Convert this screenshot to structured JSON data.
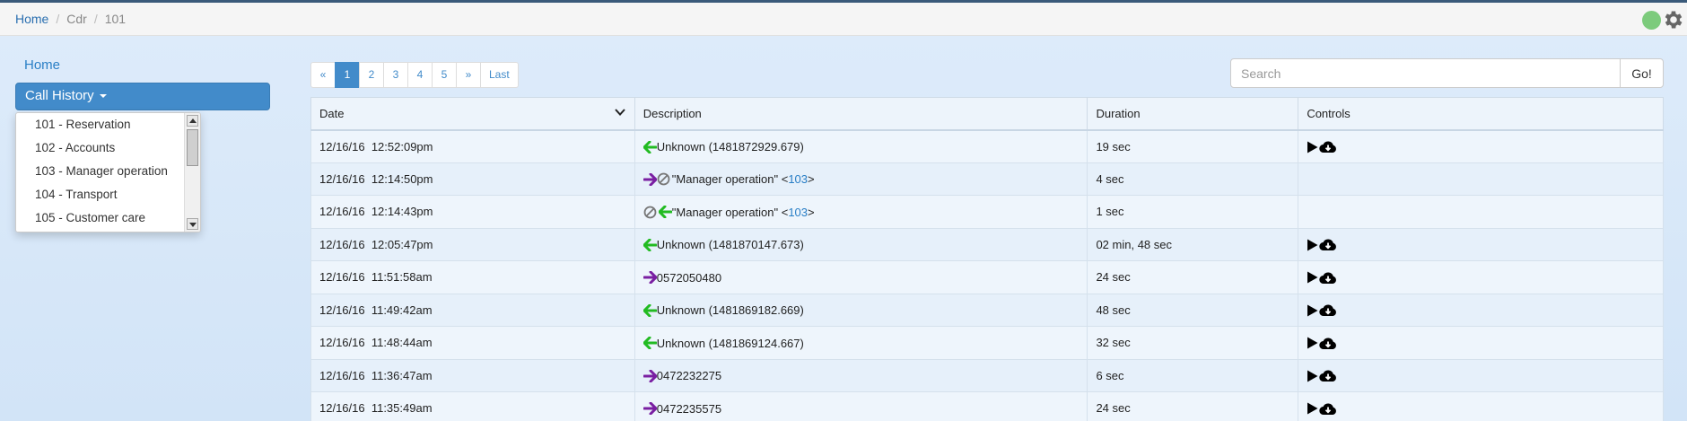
{
  "breadcrumb": {
    "home": "Home",
    "cdr": "Cdr",
    "current": "101"
  },
  "sidebar": {
    "home_link": "Home",
    "call_history_label": "Call History",
    "dropdown_items": [
      "101 - Reservation",
      "102 - Accounts",
      "103 - Manager operation",
      "104 - Transport",
      "105 - Customer care"
    ]
  },
  "pagination": [
    "«",
    "1",
    "2",
    "3",
    "4",
    "5",
    "»",
    "Last"
  ],
  "pagination_active": "1",
  "search": {
    "placeholder": "Search",
    "button": "Go!"
  },
  "table": {
    "headers": {
      "date": "Date",
      "description": "Description",
      "duration": "Duration",
      "controls": "Controls"
    },
    "rows": [
      {
        "date": "12/16/16  12:52:09pm",
        "icons": [
          "incoming"
        ],
        "text": "Unknown (1481872929.679)",
        "duration": "19 sec",
        "controls": true
      },
      {
        "date": "12/16/16  12:14:50pm",
        "icons": [
          "outgoing",
          "blocked"
        ],
        "text": "\"Manager operation\" <",
        "ext": "103",
        "suffix": ">",
        "duration": "4 sec",
        "controls": false
      },
      {
        "date": "12/16/16  12:14:43pm",
        "icons": [
          "blocked",
          "incoming"
        ],
        "text": "\"Manager operation\" <",
        "ext": "103",
        "suffix": ">",
        "duration": "1 sec",
        "controls": false
      },
      {
        "date": "12/16/16  12:05:47pm",
        "icons": [
          "incoming"
        ],
        "text": "Unknown (1481870147.673)",
        "duration": "02 min, 48 sec",
        "controls": true
      },
      {
        "date": "12/16/16  11:51:58am",
        "icons": [
          "outgoing"
        ],
        "text": "0572050480",
        "duration": "24 sec",
        "controls": true
      },
      {
        "date": "12/16/16  11:49:42am",
        "icons": [
          "incoming"
        ],
        "text": "Unknown (1481869182.669)",
        "duration": "48 sec",
        "controls": true
      },
      {
        "date": "12/16/16  11:48:44am",
        "icons": [
          "incoming"
        ],
        "text": "Unknown (1481869124.667)",
        "duration": "32 sec",
        "controls": true
      },
      {
        "date": "12/16/16  11:36:47am",
        "icons": [
          "outgoing"
        ],
        "text": "0472232275",
        "duration": "6 sec",
        "controls": true
      },
      {
        "date": "12/16/16  11:35:49am",
        "icons": [
          "outgoing"
        ],
        "text": "0472235575",
        "duration": "24 sec",
        "controls": true
      }
    ]
  },
  "colors": {
    "incoming_arrow": "#22bb22",
    "outgoing_arrow": "#7a1fa2",
    "primary": "#428bca",
    "status_dot": "#7ccb7c"
  }
}
